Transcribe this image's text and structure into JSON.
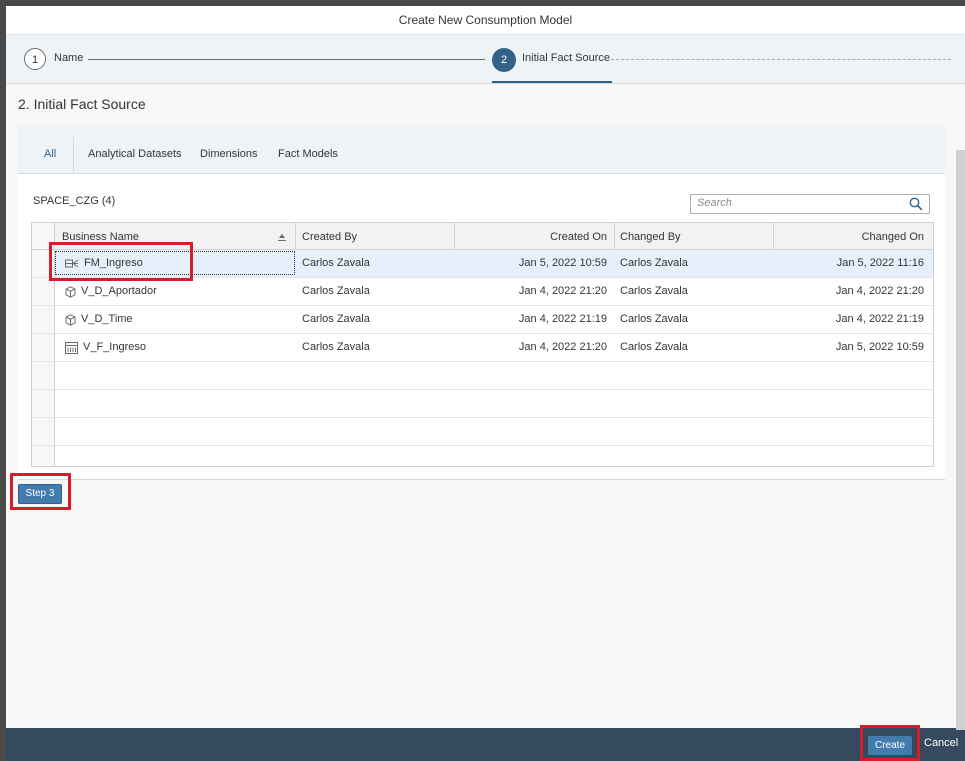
{
  "dialog": {
    "title": "Create New Consumption Model"
  },
  "wizard": {
    "steps": [
      {
        "number": "1",
        "label": "Name"
      },
      {
        "number": "2",
        "label": "Initial Fact Source"
      }
    ]
  },
  "section_title": "2. Initial Fact Source",
  "tabs": [
    "All",
    "Analytical Datasets",
    "Dimensions",
    "Fact Models"
  ],
  "space_label": "SPACE_CZG (4)",
  "search": {
    "placeholder": "Search"
  },
  "table": {
    "headers": [
      "Business Name",
      "Created By",
      "Created On",
      "Changed By",
      "Changed On"
    ],
    "rows": [
      {
        "name": "FM_Ingreso",
        "icon": "fact-model-icon",
        "created_by": "Carlos Zavala",
        "created_on": "Jan 5, 2022 10:59",
        "changed_by": "Carlos Zavala",
        "changed_on": "Jan 5, 2022 11:16"
      },
      {
        "name": "V_D_Aportador",
        "icon": "dimension-icon",
        "created_by": "Carlos Zavala",
        "created_on": "Jan 4, 2022 21:20",
        "changed_by": "Carlos Zavala",
        "changed_on": "Jan 4, 2022 21:20"
      },
      {
        "name": "V_D_Time",
        "icon": "dimension-icon",
        "created_by": "Carlos Zavala",
        "created_on": "Jan 4, 2022 21:19",
        "changed_by": "Carlos Zavala",
        "changed_on": "Jan 4, 2022 21:19"
      },
      {
        "name": "V_F_Ingreso",
        "icon": "analytical-dataset-icon",
        "created_by": "Carlos Zavala",
        "created_on": "Jan 4, 2022 21:20",
        "changed_by": "Carlos Zavala",
        "changed_on": "Jan 5, 2022 10:59"
      }
    ]
  },
  "buttons": {
    "step3": "Step 3",
    "create": "Create",
    "cancel": "Cancel"
  },
  "colors": {
    "highlight": "#d1202c",
    "accent": "#346187",
    "button": "#427cac",
    "footer": "#354a5f"
  }
}
